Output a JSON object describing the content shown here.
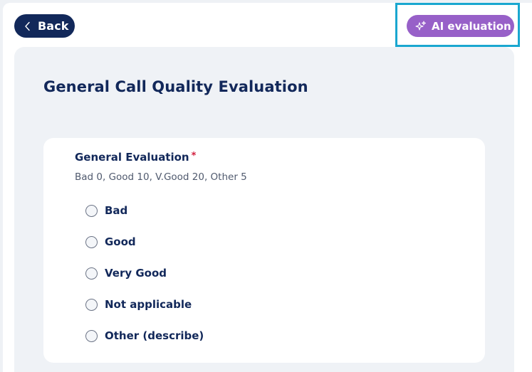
{
  "header": {
    "back_label": "Back",
    "ai_label": "AI evaluation"
  },
  "colors": {
    "navy": "#12285a",
    "purple": "#9760c8",
    "highlight": "#1aa7d0",
    "required": "#d11e3d"
  },
  "page": {
    "title": "General Call Quality Evaluation"
  },
  "question": {
    "label": "General Evaluation",
    "required_mark": "*",
    "help": "Bad 0, Good 10, V.Good 20, Other 5",
    "options": [
      {
        "label": "Bad",
        "selected": false
      },
      {
        "label": "Good",
        "selected": false
      },
      {
        "label": "Very Good",
        "selected": false
      },
      {
        "label": "Not applicable",
        "selected": false
      },
      {
        "label": "Other (describe)",
        "selected": false
      }
    ]
  }
}
